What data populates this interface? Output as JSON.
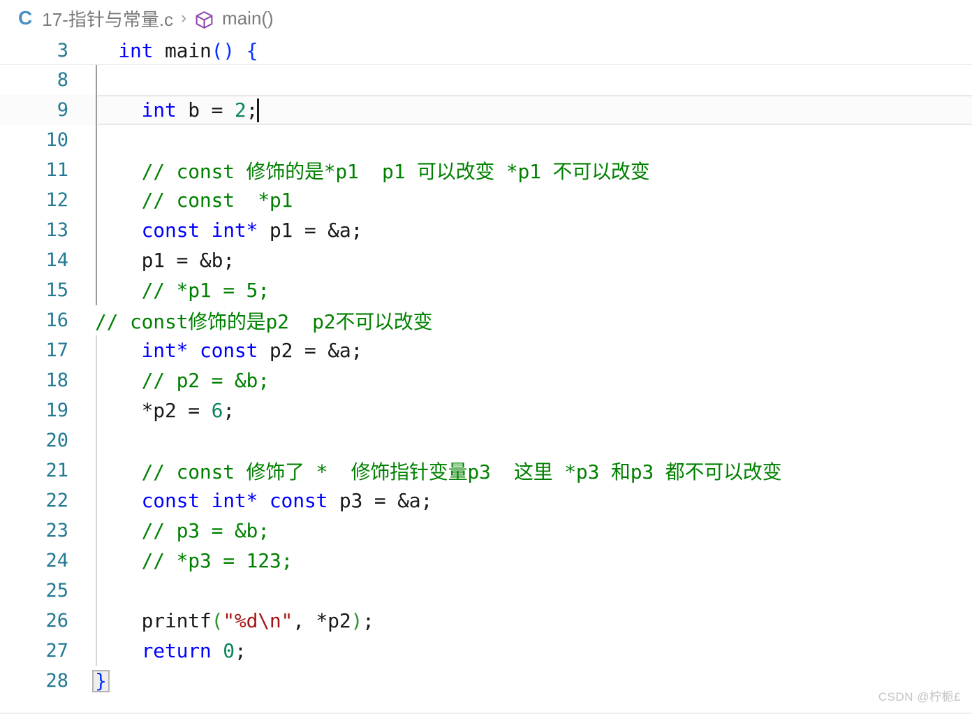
{
  "breadcrumb": {
    "file_icon_label": "C",
    "file_name": "17-指针与常量.c",
    "separator": "›",
    "symbol_icon": "symbol-method-icon",
    "symbol_name": "main()"
  },
  "sticky_scroll": {
    "number": "3",
    "tokens": [
      {
        "text": "  ",
        "cls": "t-plain"
      },
      {
        "text": "int",
        "cls": "t-key"
      },
      {
        "text": " main",
        "cls": "t-plain"
      },
      {
        "text": "()",
        "cls": "t-brk1"
      },
      {
        "text": " ",
        "cls": "t-plain"
      },
      {
        "text": "{",
        "cls": "t-brk1"
      }
    ]
  },
  "editor": {
    "lines": [
      {
        "number": "8",
        "current": false,
        "guide": "active",
        "tokens": []
      },
      {
        "number": "9",
        "current": true,
        "guide": "active",
        "caret": true,
        "tokens": [
          {
            "text": "    ",
            "cls": "t-plain"
          },
          {
            "text": "int",
            "cls": "t-key"
          },
          {
            "text": " b = ",
            "cls": "t-plain"
          },
          {
            "text": "2",
            "cls": "t-num"
          },
          {
            "text": ";",
            "cls": "t-plain"
          }
        ]
      },
      {
        "number": "10",
        "current": false,
        "guide": "active",
        "tokens": []
      },
      {
        "number": "11",
        "current": false,
        "guide": "active",
        "tokens": [
          {
            "text": "    // const 修饰的是*p1  p1 可以改变 *p1 不可以改变",
            "cls": "t-comment"
          }
        ]
      },
      {
        "number": "12",
        "current": false,
        "guide": "active",
        "tokens": [
          {
            "text": "    // const  *p1",
            "cls": "t-comment"
          }
        ]
      },
      {
        "number": "13",
        "current": false,
        "guide": "active",
        "tokens": [
          {
            "text": "    ",
            "cls": "t-plain"
          },
          {
            "text": "const int*",
            "cls": "t-key"
          },
          {
            "text": " p1 = &a;",
            "cls": "t-plain"
          }
        ]
      },
      {
        "number": "14",
        "current": false,
        "guide": "active",
        "tokens": [
          {
            "text": "    p1 = &b;",
            "cls": "t-plain"
          }
        ]
      },
      {
        "number": "15",
        "current": false,
        "guide": "active",
        "tokens": [
          {
            "text": "    // *p1 = 5;",
            "cls": "t-comment"
          }
        ]
      },
      {
        "number": "16",
        "current": false,
        "guide": "none",
        "tokens": [
          {
            "text": "// const修饰的是p2  p2不可以改变",
            "cls": "t-comment"
          }
        ]
      },
      {
        "number": "17",
        "current": false,
        "guide": "normal",
        "tokens": [
          {
            "text": "    ",
            "cls": "t-plain"
          },
          {
            "text": "int*",
            "cls": "t-key"
          },
          {
            "text": " ",
            "cls": "t-plain"
          },
          {
            "text": "const",
            "cls": "t-key"
          },
          {
            "text": " p2 = &a;",
            "cls": "t-plain"
          }
        ]
      },
      {
        "number": "18",
        "current": false,
        "guide": "normal",
        "tokens": [
          {
            "text": "    // p2 = &b;",
            "cls": "t-comment"
          }
        ]
      },
      {
        "number": "19",
        "current": false,
        "guide": "normal",
        "tokens": [
          {
            "text": "    *p2 = ",
            "cls": "t-plain"
          },
          {
            "text": "6",
            "cls": "t-num"
          },
          {
            "text": ";",
            "cls": "t-plain"
          }
        ]
      },
      {
        "number": "20",
        "current": false,
        "guide": "normal",
        "tokens": []
      },
      {
        "number": "21",
        "current": false,
        "guide": "normal",
        "tokens": [
          {
            "text": "    // const 修饰了 *  修饰指针变量p3  这里 *p3 和p3 都不可以改变",
            "cls": "t-comment"
          }
        ]
      },
      {
        "number": "22",
        "current": false,
        "guide": "normal",
        "tokens": [
          {
            "text": "    ",
            "cls": "t-plain"
          },
          {
            "text": "const int*",
            "cls": "t-key"
          },
          {
            "text": " ",
            "cls": "t-plain"
          },
          {
            "text": "const",
            "cls": "t-key"
          },
          {
            "text": " p3 = &a;",
            "cls": "t-plain"
          }
        ]
      },
      {
        "number": "23",
        "current": false,
        "guide": "normal",
        "tokens": [
          {
            "text": "    // p3 = &b;",
            "cls": "t-comment"
          }
        ]
      },
      {
        "number": "24",
        "current": false,
        "guide": "normal",
        "tokens": [
          {
            "text": "    // *p3 = 123;",
            "cls": "t-comment"
          }
        ]
      },
      {
        "number": "25",
        "current": false,
        "guide": "normal",
        "tokens": []
      },
      {
        "number": "26",
        "current": false,
        "guide": "normal",
        "tokens": [
          {
            "text": "    printf",
            "cls": "t-plain"
          },
          {
            "text": "(",
            "cls": "t-brk2"
          },
          {
            "text": "\"%d\\n\"",
            "cls": "t-str"
          },
          {
            "text": ", *p2",
            "cls": "t-plain"
          },
          {
            "text": ")",
            "cls": "t-brk2"
          },
          {
            "text": ";",
            "cls": "t-plain"
          }
        ]
      },
      {
        "number": "27",
        "current": false,
        "guide": "normal",
        "tokens": [
          {
            "text": "    ",
            "cls": "t-plain"
          },
          {
            "text": "return",
            "cls": "t-key"
          },
          {
            "text": " ",
            "cls": "t-plain"
          },
          {
            "text": "0",
            "cls": "t-num"
          },
          {
            "text": ";",
            "cls": "t-plain"
          }
        ]
      },
      {
        "number": "28",
        "current": false,
        "guide": "none",
        "bracket_match": "}",
        "tokens": []
      }
    ]
  },
  "watermark": {
    "text": "CSDN @柠栀£"
  },
  "colors": {
    "keyword": "#0000ff",
    "comment": "#008000",
    "number": "#098658",
    "string": "#a31515",
    "line_number": "#237a93",
    "bracket_blue": "#0431fa",
    "bracket_green": "#319331",
    "breadcrumb_text": "#7b7b7b",
    "c_icon": "#4a90c2",
    "symbol_icon": "#8e44ad"
  }
}
